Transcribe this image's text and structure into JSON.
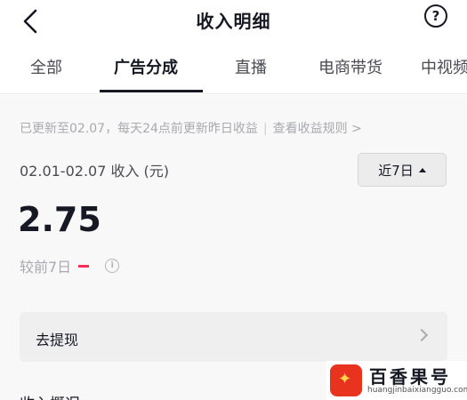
{
  "header": {
    "title": "收入明细",
    "help_symbol": "?"
  },
  "tabs": [
    {
      "label": "全部",
      "active": false
    },
    {
      "label": "广告分成",
      "active": true
    },
    {
      "label": "直播",
      "active": false
    },
    {
      "label": "电商带货",
      "active": false
    },
    {
      "label": "中视频",
      "active": false
    }
  ],
  "summary": {
    "update_note": "已更新至02.07，每天24点前更新昨日收益",
    "rules_link": "查看收益规则",
    "rules_arrow": ">",
    "period_label": "02.01-02.07 收入 (元)",
    "range_select": "近7日",
    "amount": "2.75",
    "compare_label": "较前7日",
    "info_symbol": "i"
  },
  "withdraw": {
    "label": "去提现"
  },
  "overview": {
    "title": "收入概况"
  },
  "watermark": {
    "name": "百香果号",
    "url": "huangjinbaixiangguo.com"
  },
  "colors": {
    "accent_red": "#fe2c55",
    "text_primary": "#161823",
    "text_secondary": "#a9aaae"
  }
}
